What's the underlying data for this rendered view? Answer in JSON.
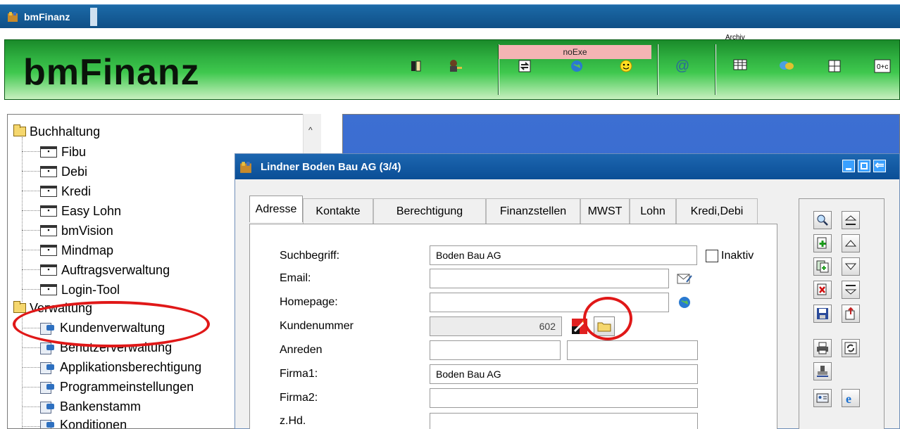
{
  "app": {
    "title": "bmFinanz",
    "logo": "bmFinanz",
    "colors": {
      "accent_green": "#2fb040",
      "title_blue": "#0f4f86",
      "annotation_red": "#e01818"
    }
  },
  "toolbar": {
    "status_label": "noExe",
    "archiv_label": "Archiv",
    "icons": [
      "book-icon",
      "user-key-icon",
      "exchange-icon",
      "globe-icon",
      "smiley-icon",
      "at-icon",
      "archive-grid-icon",
      "chat-icon",
      "grid-icon",
      "calculator-icon"
    ]
  },
  "tree": {
    "groups": [
      {
        "label": "Buchhaltung",
        "items": [
          "Fibu",
          "Debi",
          "Kredi",
          "Easy Lohn",
          "bmVision",
          "Mindmap",
          "Auftragsverwaltung",
          "Login-Tool"
        ]
      },
      {
        "label": "Verwaltung",
        "items": [
          "Kundenverwaltung",
          "Benutzerverwaltung",
          "Applikationsberechtigung",
          "Programmeinstellungen",
          "Bankenstamm",
          "Konditionen"
        ]
      }
    ]
  },
  "dialog": {
    "title": "Lindner Boden Bau AG (3/4)",
    "tabs": [
      "Adresse",
      "Kontakte",
      "Berechtigung",
      "Finanzstellen",
      "MWST",
      "Lohn",
      "Kredi,Debi"
    ],
    "active_tab": "Adresse",
    "fields": {
      "suchbegriff": {
        "label": "Suchbegriff:",
        "value": "Boden Bau AG"
      },
      "inaktiv": {
        "label": "Inaktiv",
        "checked": false
      },
      "email": {
        "label": "Email:",
        "value": ""
      },
      "homepage": {
        "label": "Homepage:",
        "value": ""
      },
      "kundennummer": {
        "label": "Kundenummer",
        "value": "602"
      },
      "anreden": {
        "label": "Anreden",
        "value1": "",
        "value2": ""
      },
      "firma1": {
        "label": "Firma1:",
        "value": "Boden Bau AG"
      },
      "firma2": {
        "label": "Firma2:",
        "value": ""
      },
      "zhd": {
        "label": "z.Hd.",
        "value": ""
      }
    }
  }
}
